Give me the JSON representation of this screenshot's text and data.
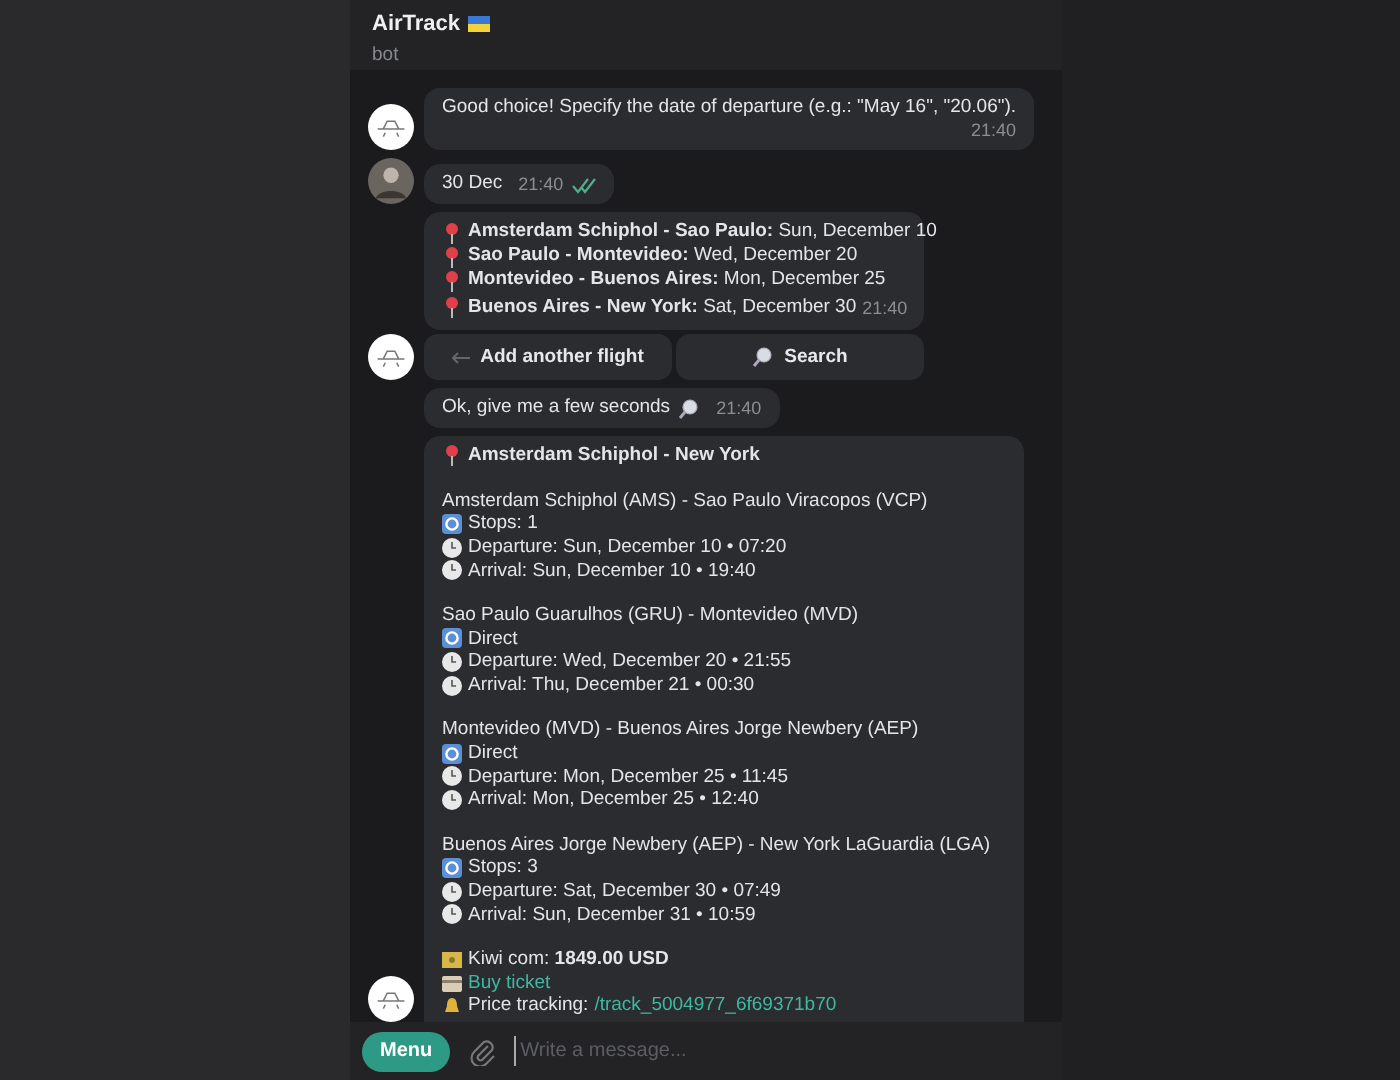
{
  "header": {
    "title": "AirTrack",
    "subtitle": "bot"
  },
  "messages": [
    {
      "kind": "incoming",
      "avatar": true,
      "text": "Good choice! Specify the date of departure (e.g.: \"May 16\", \"20.06\").",
      "time": "21:40"
    },
    {
      "kind": "outgoing",
      "avatar": true,
      "text": "30 Dec",
      "time": "21:40",
      "read": true
    },
    {
      "kind": "legs",
      "avatar": true,
      "time": "21:40",
      "legs": [
        {
          "route": "Amsterdam Schiphol - Sao Paulo:",
          "date": "Sun, December 10"
        },
        {
          "route": "Sao Paulo - Montevideo:",
          "date": "Wed, December 20"
        },
        {
          "route": "Montevideo - Buenos Aires:",
          "date": "Mon, December 25"
        },
        {
          "route": "Buenos Aires - New York:",
          "date": "Sat, December 30"
        }
      ],
      "buttons": [
        "Add another flight",
        "Search"
      ]
    },
    {
      "kind": "waiting",
      "avatar": false,
      "text": "Ok, give me a few seconds",
      "time": "21:40"
    },
    {
      "kind": "result",
      "avatar": true,
      "title": "Amsterdam Schiphol - New York",
      "segments": [
        {
          "route": "Amsterdam Schiphol (AMS) - Sao Paulo Viracopos (VCP)",
          "stops": "Stops: 1",
          "departure": "Departure: Sun, December 10 • 07:20",
          "arrival": "Arrival: Sun, December 10 • 19:40"
        },
        {
          "route": "Sao Paulo Guarulhos (GRU) - Montevideo (MVD)",
          "stops": "Direct",
          "departure": "Departure: Wed, December 20 • 21:55",
          "arrival": "Arrival: Thu, December 21 • 00:30"
        },
        {
          "route": "Montevideo (MVD) - Buenos Aires Jorge Newbery (AEP)",
          "stops": "Direct",
          "departure": "Departure: Mon, December 25 • 11:45",
          "arrival": "Arrival: Mon, December 25 • 12:40"
        },
        {
          "route": "Buenos Aires Jorge Newbery (AEP) - New York LaGuardia (LGA)",
          "stops": "Stops: 3",
          "departure": "Departure: Sat, December 30 • 07:49",
          "arrival": "Arrival: Sun, December 31 • 10:59"
        }
      ],
      "price_label": "Kiwi com:",
      "price": "1849.00 USD",
      "buy": "Buy ticket",
      "tracking_label": "Price tracking:",
      "tracking_link": "/track_5004977_6f69371b70"
    }
  ],
  "composer": {
    "menu": "Menu",
    "placeholder": "Write a message..."
  }
}
